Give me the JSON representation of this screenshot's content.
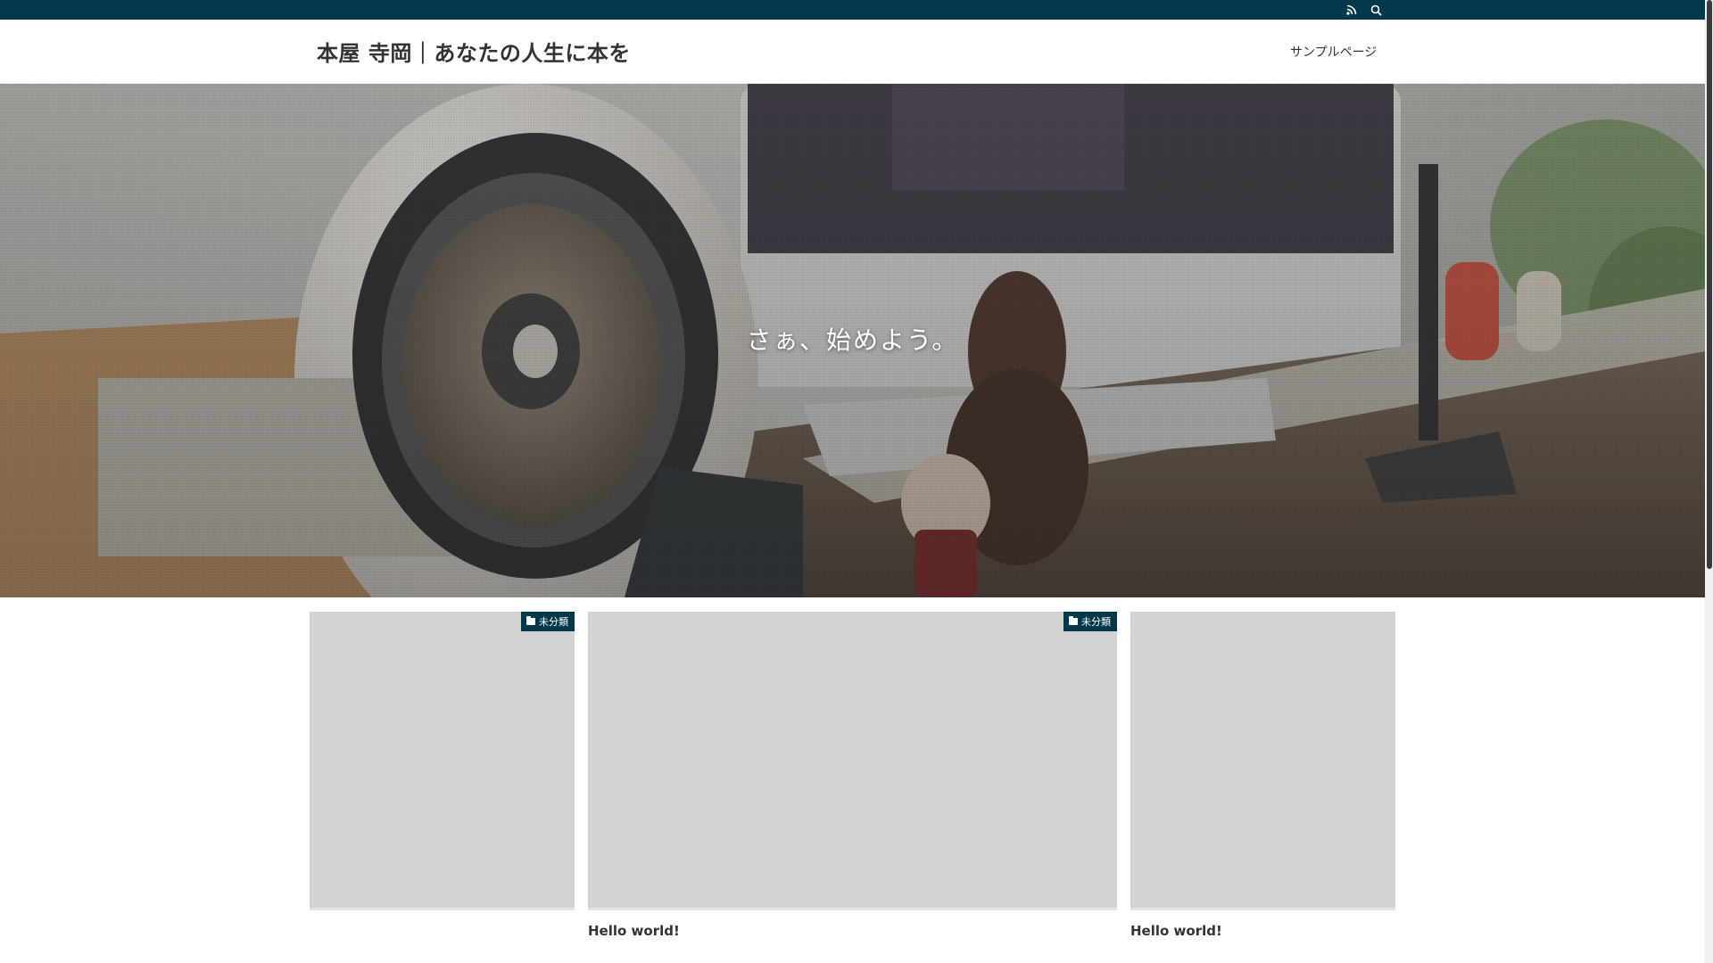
{
  "site": {
    "title": "本屋 寺岡｜あなたの人生に本を"
  },
  "topbar": {
    "icons": [
      "rss-icon",
      "search-icon"
    ]
  },
  "nav": {
    "items": [
      {
        "label": "サンプルページ"
      }
    ]
  },
  "hero": {
    "copy": "さぁ、始めよう。"
  },
  "posts": [
    {
      "category": "未分類",
      "title": ""
    },
    {
      "category": "未分類",
      "title": "Hello world!"
    },
    {
      "category": "",
      "title": "Hello world!"
    }
  ],
  "colors": {
    "accent": "#04384c",
    "thumb_placeholder": "#d2d2d2",
    "text": "#333333"
  }
}
